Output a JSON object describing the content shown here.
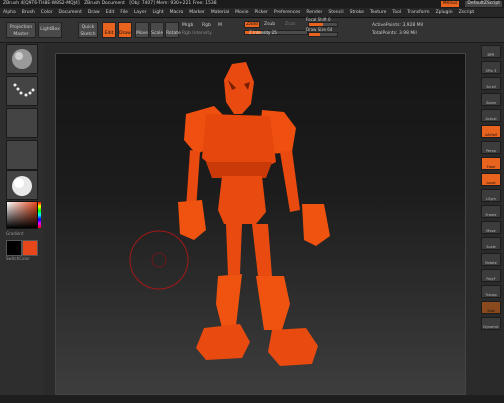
{
  "app": {
    "title": "ZBrush 4[Q9T6-TH8E-W8S2-MQJ4]",
    "document": "ZBrush Document",
    "stats": "[Obj: 7407] Mem: 930+221 Free: 1538",
    "buttons": [
      "Menus",
      "DefaultZScript"
    ]
  },
  "menu": [
    "Alpha",
    "Brush",
    "Color",
    "Document",
    "Draw",
    "Edit",
    "File",
    "Layer",
    "Light",
    "Macro",
    "Marker",
    "Material",
    "Movie",
    "Picker",
    "Preferences",
    "Render",
    "Stencil",
    "Stroke",
    "Texture",
    "Tool",
    "Transform",
    "Zplugin",
    "Zscript"
  ],
  "toolbar": {
    "projection": "Projection Master",
    "lightbox": "LightBox",
    "quicksketch": "Quick Sketch",
    "edit": "Edit",
    "draw": "Draw",
    "move": "Move",
    "scale": "Scale",
    "rotate": "Rotate",
    "mrgb": "Mrgb",
    "rgb": "Rgb",
    "m": "M",
    "zadd": "Zadd",
    "zsub": "Zsub",
    "zcut": "Zcut",
    "rgb_intensity": "Rgb Intensity",
    "z_intensity": "Z Intensity 25",
    "focal_shift": "Focal Shift 0",
    "draw_size": "Draw Size 64",
    "active_points": "ActivePoints: 3,928 Mil",
    "total_points": "TotalPoints: 3.98 Mil",
    "focal_fill": 0.5,
    "draw_fill": 0.4,
    "zint_fill": 0.25
  },
  "left": {
    "gradient": "Gradient",
    "switchcolor": "SwitchColor",
    "main_color": "#e8471c",
    "secondary_color": "#000000"
  },
  "right": [
    "BPR",
    "SPix 3",
    "Scroll",
    "Zoom",
    "Actual",
    "AAHalf",
    "Persp",
    "Floor",
    "Local",
    "LSym",
    "Frame",
    "Move",
    "Scale",
    "Rotate",
    "PolyF",
    "Transp",
    "Solo",
    "Dynamic"
  ]
}
